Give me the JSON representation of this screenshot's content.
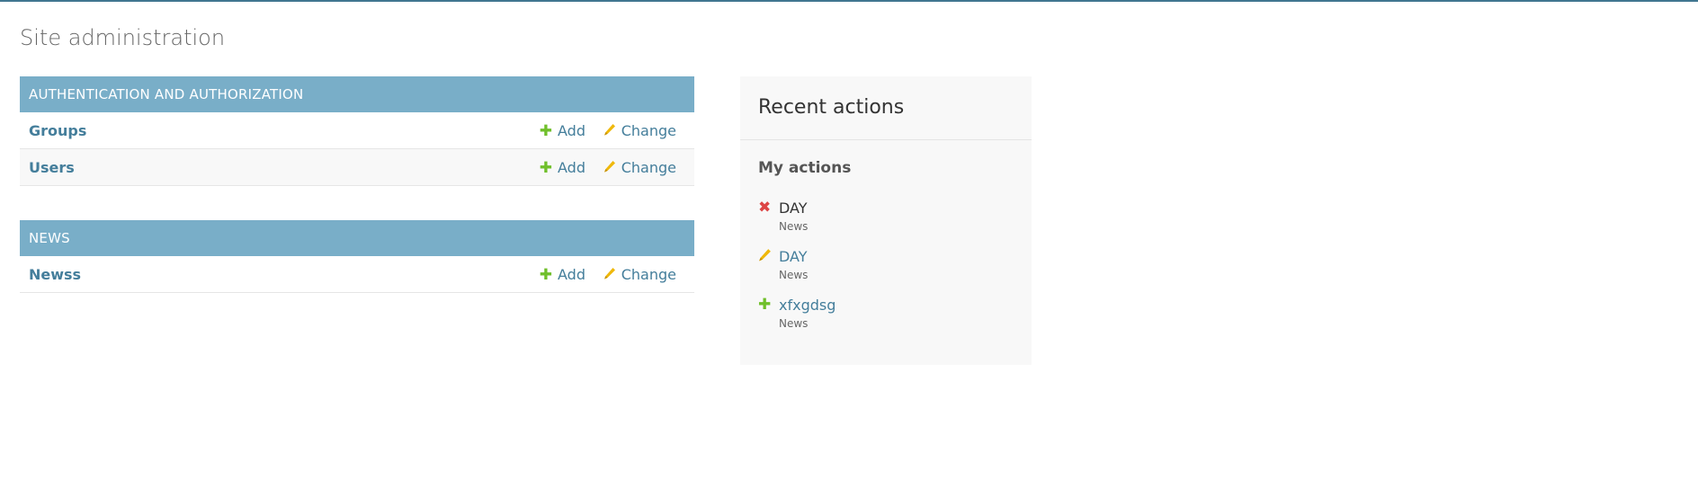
{
  "page": {
    "title": "Site administration"
  },
  "modules": [
    {
      "header": "AUTHENTICATION AND AUTHORIZATION",
      "models": [
        {
          "name": "Groups",
          "add_label": "Add",
          "change_label": "Change"
        },
        {
          "name": "Users",
          "add_label": "Add",
          "change_label": "Change"
        }
      ]
    },
    {
      "header": "NEWS",
      "models": [
        {
          "name": "Newss",
          "add_label": "Add",
          "change_label": "Change"
        }
      ]
    }
  ],
  "recent_actions": {
    "title": "Recent actions",
    "subtitle": "My actions",
    "items": [
      {
        "icon": "delete-icon",
        "label": "DAY",
        "type": "News"
      },
      {
        "icon": "pencil-icon",
        "label": "DAY",
        "type": "News"
      },
      {
        "icon": "plus-icon",
        "label": "xfxgdsg",
        "type": "News"
      }
    ]
  },
  "colors": {
    "top_bar": "#417690",
    "module_header": "#79aec8",
    "link": "#447e9b",
    "add_icon": "#70bf2b",
    "change_icon": "#efb80b",
    "delete_icon": "#dd4646"
  }
}
